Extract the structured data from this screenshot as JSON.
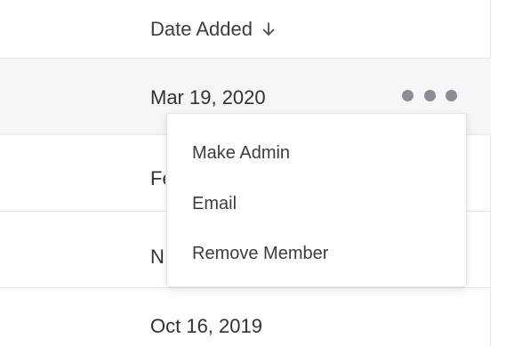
{
  "header": {
    "column_label": "Date Added",
    "sort_icon": "arrow-down-icon"
  },
  "rows": [
    {
      "date": "Mar 19, 2020"
    },
    {
      "date": "Fe"
    },
    {
      "date": "N"
    },
    {
      "date": "Oct 16, 2019"
    }
  ],
  "row_actions": {
    "icon": "more-horizontal-icon"
  },
  "menu": {
    "items": [
      {
        "label": "Make Admin"
      },
      {
        "label": "Email"
      },
      {
        "label": "Remove Member"
      }
    ]
  },
  "colors": {
    "highlight_row": "#f5f6f8",
    "divider": "#e6e7ea",
    "kebab_dot": "#8a8d97"
  }
}
